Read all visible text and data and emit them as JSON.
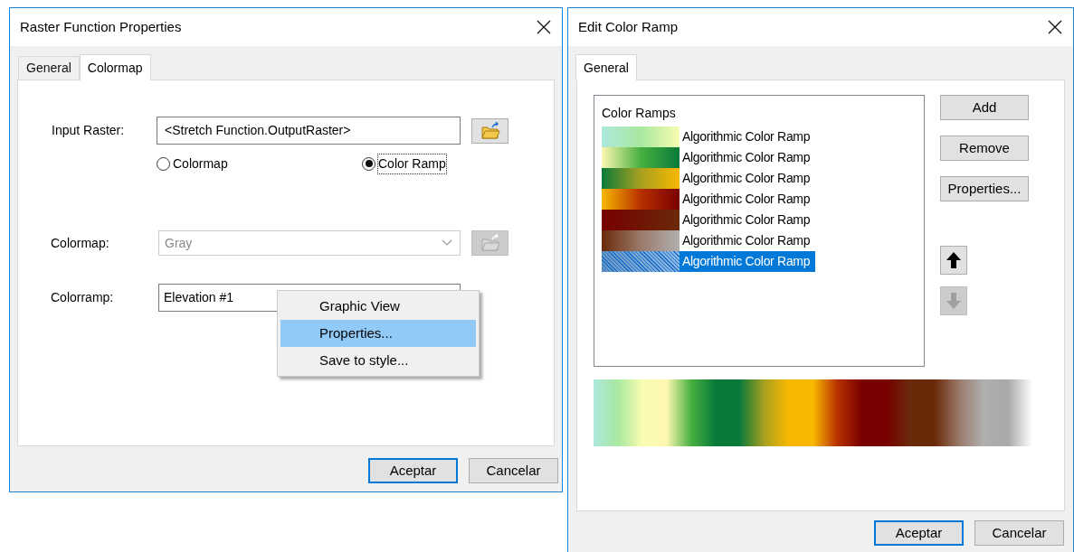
{
  "raster_dialog": {
    "title": "Raster Function Properties",
    "tabs": [
      {
        "label": "General",
        "selected": false
      },
      {
        "label": "Colormap",
        "selected": true
      }
    ],
    "input_raster": {
      "label": "Input Raster:",
      "value": "<Stretch Function.OutputRaster>"
    },
    "radios": [
      {
        "label": "Colormap",
        "selected": false
      },
      {
        "label": "Color Ramp",
        "selected": true
      }
    ],
    "colormap": {
      "label": "Colormap:",
      "value": "Gray",
      "disabled": true
    },
    "colorramp": {
      "label": "Colorramp:",
      "value": "Elevation #1"
    },
    "context_menu": [
      {
        "label": "Graphic View",
        "selected": false
      },
      {
        "label": "Properties...",
        "selected": true
      },
      {
        "label": "Save to style...",
        "selected": false
      }
    ],
    "buttons": [
      {
        "label": "Aceptar",
        "default": true
      },
      {
        "label": "Cancelar",
        "default": false
      }
    ]
  },
  "ramp_dialog": {
    "title": "Edit Color Ramp",
    "tabs": [
      {
        "label": "General",
        "selected": true
      }
    ],
    "list_header": "Color Ramps",
    "ramps": [
      {
        "label": "Algorithmic Color Ramp",
        "selected": false
      },
      {
        "label": "Algorithmic Color Ramp",
        "selected": false
      },
      {
        "label": "Algorithmic Color Ramp",
        "selected": false
      },
      {
        "label": "Algorithmic Color Ramp",
        "selected": false
      },
      {
        "label": "Algorithmic Color Ramp",
        "selected": false
      },
      {
        "label": "Algorithmic Color Ramp",
        "selected": false
      },
      {
        "label": "Algorithmic Color Ramp",
        "selected": true
      }
    ],
    "side_buttons": [
      {
        "label": "Add"
      },
      {
        "label": "Remove"
      },
      {
        "label": "Properties..."
      }
    ],
    "move_buttons": [
      {
        "kind": "up",
        "disabled": false
      },
      {
        "kind": "down",
        "disabled": true
      }
    ],
    "buttons": [
      {
        "label": "Aceptar",
        "default": true
      },
      {
        "label": "Cancelar",
        "default": false
      }
    ]
  }
}
